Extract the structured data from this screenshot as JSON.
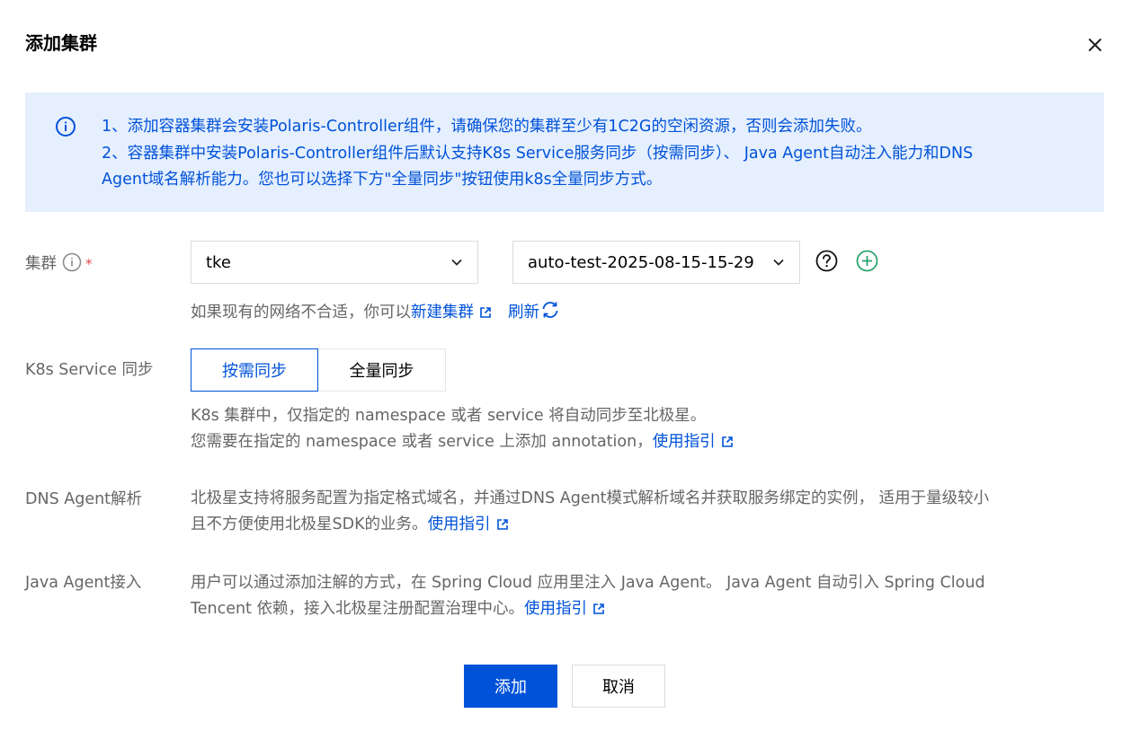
{
  "dialog": {
    "title": "添加集群",
    "close_icon": "close-icon"
  },
  "notice": {
    "icon": "info-circle-icon",
    "line1": "1、添加容器集群会安装Polaris-Controller组件，请确保您的集群至少有1C2G的空闲资源，否则会添加失败。",
    "line2": "2、容器集群中安装Polaris-Controller组件后默认支持K8s Service服务同步（按需同步）、 Java Agent自动注入能力和DNS",
    "line3": "Agent域名解析能力。您也可以选择下方\"全量同步\"按钮使用k8s全量同步方式。"
  },
  "cluster": {
    "label": "集群",
    "required_mark": "*",
    "type_select_value": "tke",
    "cluster_select_value": "auto-test-2025-08-15-15-29",
    "helper_prefix": "如果现有的网络不合适，你可以",
    "create_link": "新建集群",
    "refresh_link": "刷新"
  },
  "k8s_service": {
    "label": "K8s Service 同步",
    "options": [
      "按需同步",
      "全量同步"
    ],
    "selected": "按需同步",
    "desc_line1": "K8s 集群中，仅指定的 namespace 或者 service 将自动同步至北极星。",
    "desc_line2": "您需要在指定的 namespace 或者 service 上添加 annotation，",
    "guide_link": "使用指引"
  },
  "dns_agent": {
    "label": "DNS Agent解析",
    "desc_line1": "北极星支持将服务配置为指定格式域名，并通过DNS Agent模式解析域名并获取服务绑定的实例， 适用于量级较小",
    "desc_line2": "且不方便使用北极星SDK的业务。",
    "guide_link": "使用指引"
  },
  "java_agent": {
    "label": "Java Agent接入",
    "desc_line1": "用户可以通过添加注解的方式，在 Spring Cloud 应用里注入 Java Agent。 Java Agent 自动引入 Spring Cloud",
    "desc_line2": "Tencent 依赖，接入北极星注册配置治理中心。",
    "guide_link": "使用指引"
  },
  "footer": {
    "confirm_label": "添加",
    "cancel_label": "取消"
  },
  "colors": {
    "brand": "#0052d9",
    "notice_bg": "#e5effe",
    "add_green": "#2ba471",
    "required_red": "#e54545"
  }
}
